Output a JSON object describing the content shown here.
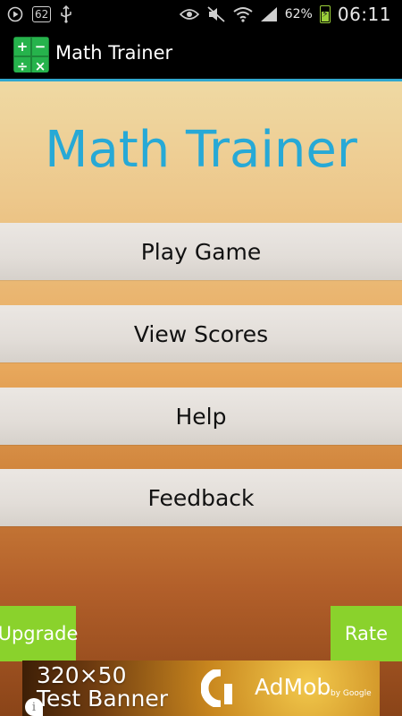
{
  "status_bar": {
    "notification_count": "62",
    "battery_percent": "62%",
    "clock": "06:11",
    "icons": [
      "media-play-icon",
      "notification-badge-icon",
      "usb-icon",
      "eye-icon",
      "mute-icon",
      "wifi-icon",
      "signal-icon",
      "battery-charging-icon"
    ]
  },
  "action_bar": {
    "title": "Math Trainer",
    "app_icon_symbols": [
      "+",
      "−",
      "÷",
      "×"
    ]
  },
  "main": {
    "title": "Math Trainer",
    "buttons": [
      {
        "label": "Play Game"
      },
      {
        "label": "View Scores"
      },
      {
        "label": "Help"
      },
      {
        "label": "Feedback"
      }
    ],
    "upgrade_label": "Upgrade",
    "rate_label": "Rate"
  },
  "ad_banner": {
    "line1": "320×50",
    "line2": "Test Banner",
    "brand": "AdMob",
    "brand_sub": "by Google",
    "info_icon": "i"
  },
  "colors": {
    "accent": "#2fa7cf",
    "title": "#27a9d6",
    "green_button": "#8ad22c",
    "app_icon": "#26b34c"
  }
}
